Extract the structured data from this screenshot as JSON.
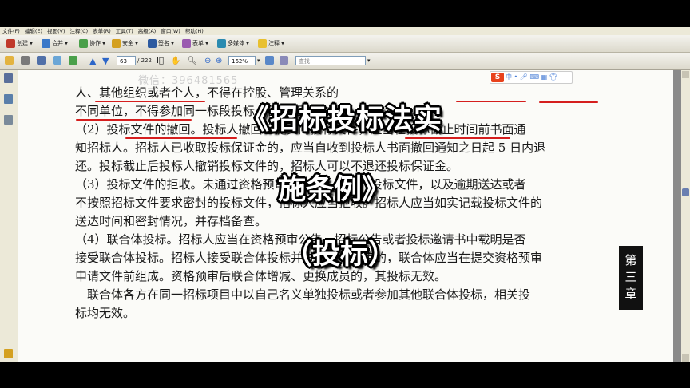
{
  "menubar": [
    "文件(F)",
    "编辑(E)",
    "视图(V)",
    "注释(C)",
    "表单(R)",
    "工具(T)",
    "高级(A)",
    "窗口(W)",
    "帮助(H)"
  ],
  "toolbar1": {
    "create": "创建",
    "combine": "合并",
    "collaborate": "协作",
    "secure": "安全",
    "sign": "签名",
    "forms": "表单",
    "multimedia": "多媒体",
    "comment": "注释"
  },
  "toolbar2": {
    "page_current": "63",
    "page_total": "/ 222",
    "zoom": "162%",
    "find_placeholder": "查找"
  },
  "ime": {
    "logo": "S",
    "mode": "中"
  },
  "watermark": "微信：396481565",
  "document": {
    "lines": [
      "人、其他组织或者个人，不得在控股、管理关系的",
      "不同单位，不得参加同一标段投标，否则无效投标。",
      "（2）投标文件的撤回。投标人撤回已提交的投标文件，应当在投标截止时间前书面通",
      "知招标人。招标人已收取投标保证金的，应当自收到投标人书面撤回通知之日起 5 日内退",
      "还。投标截止后投标人撤销投标文件的，招标人可以不退还投标保证金。",
      "（3）投标文件的拒收。未通过资格预审的申请人提交的投标文件，以及逾期送达或者",
      "不按照招标文件要求密封的投标文件，招标人应当拒收。招标人应当如实记载投标文件的",
      "送达时间和密封情况，并存档备查。",
      "（4）联合体投标。招标人应当在资格预审公告、招标公告或者投标邀请书中载明是否",
      "接受联合体投标。招标人接受联合体投标并进行资格预审的，联合体应当在提交资格预审",
      "申请文件前组成。资格预审后联合体增减、更换成员的，其投标无效。",
      "　联合体各方在同一招标项目中以自己名义单独投标或者参加其他联合体投标，相关投",
      "标均无效。"
    ],
    "chapter_tab": [
      "第",
      "三",
      "章"
    ]
  },
  "overlay": {
    "title_line1": "《招标投标法实",
    "title_line2": "施条例》",
    "subtitle": "（投标）"
  },
  "colors": {
    "overlay_text": "#ffffff",
    "underline": "#d51e1e",
    "chapter_tab_bg": "#111111"
  }
}
